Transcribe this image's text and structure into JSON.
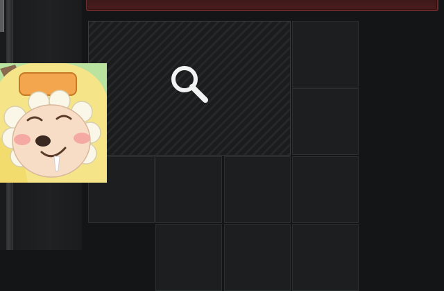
{
  "scene": {
    "theme": "dark inventory panel",
    "colors": {
      "background": "#141516",
      "banner": "#4a1d1e",
      "cell": "#1c1e1f",
      "cell_border": "#2c2f30",
      "magnifier": "#f2f2f2",
      "avatar_background": "#b9e39f"
    }
  },
  "inventory": {
    "search_slot_icon": "magnifier-icon",
    "empty_cell_count": 9
  },
  "overlay": {
    "avatar_icon": "cartoon-sheep-avatar"
  }
}
